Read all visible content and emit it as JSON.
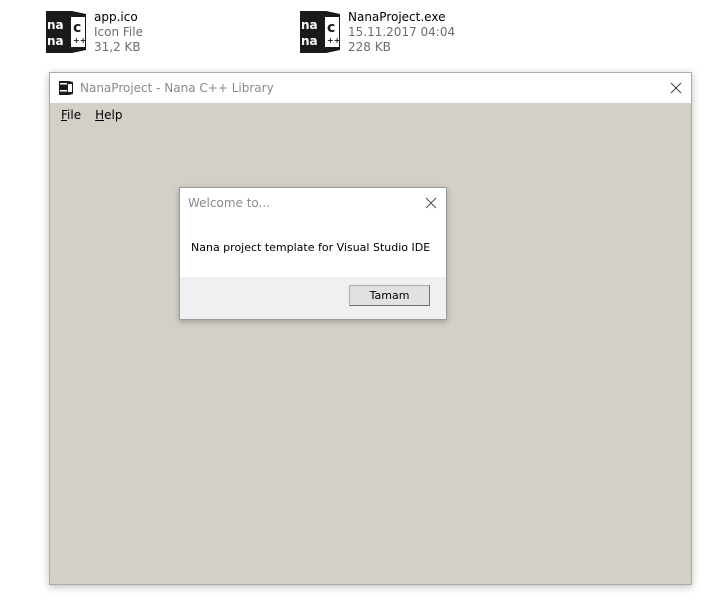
{
  "desktop": {
    "files": [
      {
        "name": "app.ico",
        "line2": "Icon File",
        "line3": "31,2 KB",
        "icon": "nana-logo-icon"
      },
      {
        "name": "NanaProject.exe",
        "line2": "15.11.2017 04:04",
        "line3": "228 KB",
        "icon": "nana-logo-icon"
      }
    ]
  },
  "window": {
    "title": "NanaProject - Nana C++ Library",
    "menu": [
      {
        "label": "File",
        "accel": "F",
        "rest": "ile"
      },
      {
        "label": "Help",
        "accel": "H",
        "rest": "elp"
      }
    ],
    "background": "#d4d0c8"
  },
  "dialog": {
    "title": "Welcome to...",
    "message": "Nana project template for Visual Studio IDE",
    "ok_label": "Tamam"
  }
}
